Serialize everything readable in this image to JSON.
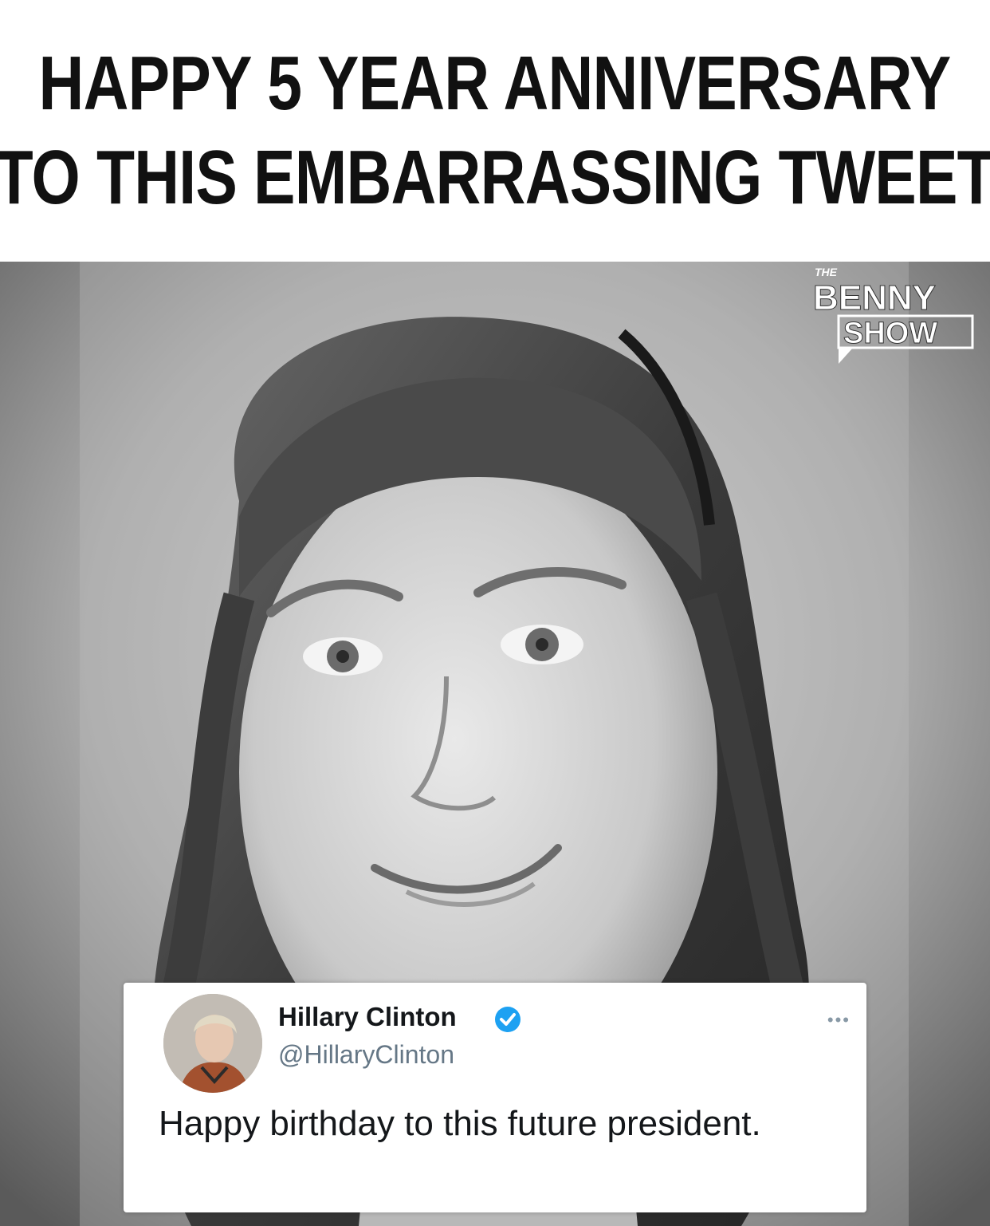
{
  "headline": {
    "line1": "HAPPY 5 YEAR ANNIVERSARY",
    "line2": "TO THIS EMBARRASSING TWEET"
  },
  "watermark": {
    "small": "THE",
    "line1": "BENNY",
    "line2": "SHOW"
  },
  "tweet": {
    "name": "Hillary Clinton",
    "handle": "@HillaryClinton",
    "text": "Happy birthday to this future president.",
    "more": "•••",
    "verified_color": "#1da1f2"
  },
  "icons": {
    "verified": "verified-badge-icon",
    "more": "more-options-icon"
  }
}
